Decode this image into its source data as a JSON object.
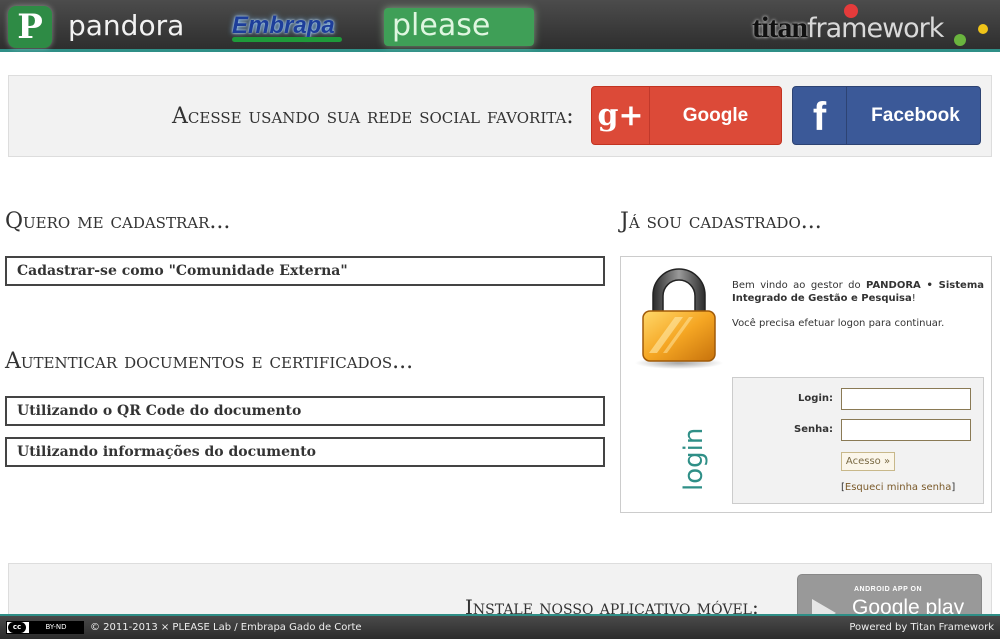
{
  "header": {
    "pandora_mark": "P",
    "pandora_text": "pandora",
    "embrapa_text": "Embrapa",
    "please_text": "please",
    "titan_word": "titan",
    "framework_word": "framework",
    "accent_color": "#2f8f87"
  },
  "social": {
    "label": "Acesse usando sua rede social favorita:",
    "google_icon": "g+",
    "google_label": "Google",
    "google_color": "#dc4a38",
    "facebook_icon": "f",
    "facebook_label": "Facebook",
    "facebook_color": "#3b5998"
  },
  "register": {
    "heading": "Quero me cadastrar...",
    "links": [
      "Cadastrar-se como \"Comunidade Externa\""
    ]
  },
  "authenticate": {
    "heading": "Autenticar documentos e certificados...",
    "links": [
      "Utilizando o QR Code do documento",
      "Utilizando informações do documento"
    ]
  },
  "login": {
    "heading": "Já sou cadastrado...",
    "welcome_prefix": "Bem vindo ao gestor do ",
    "system_name": "PANDORA • Sistema Integrado de Gestão e Pesquisa",
    "welcome_suffix": "!",
    "continue_text": "Você precisa efetuar logon para continuar.",
    "vertical_label": "login",
    "login_label": "Login:",
    "login_value": "",
    "password_label": "Senha:",
    "password_value": "",
    "submit_label": "Acesso »",
    "forgot_open": "[",
    "forgot_label": "Esqueci minha senha",
    "forgot_close": "]"
  },
  "app": {
    "label": "Instale nosso aplicativo móvel:",
    "store_small": "ANDROID APP ON",
    "store_big": "Google play"
  },
  "footer": {
    "cc_left": "cc",
    "cc_right": "BY-ND",
    "copyright": "© 2011-2013 × PLEASE Lab / Embrapa Gado de Corte",
    "powered": "Powered by Titan Framework"
  }
}
